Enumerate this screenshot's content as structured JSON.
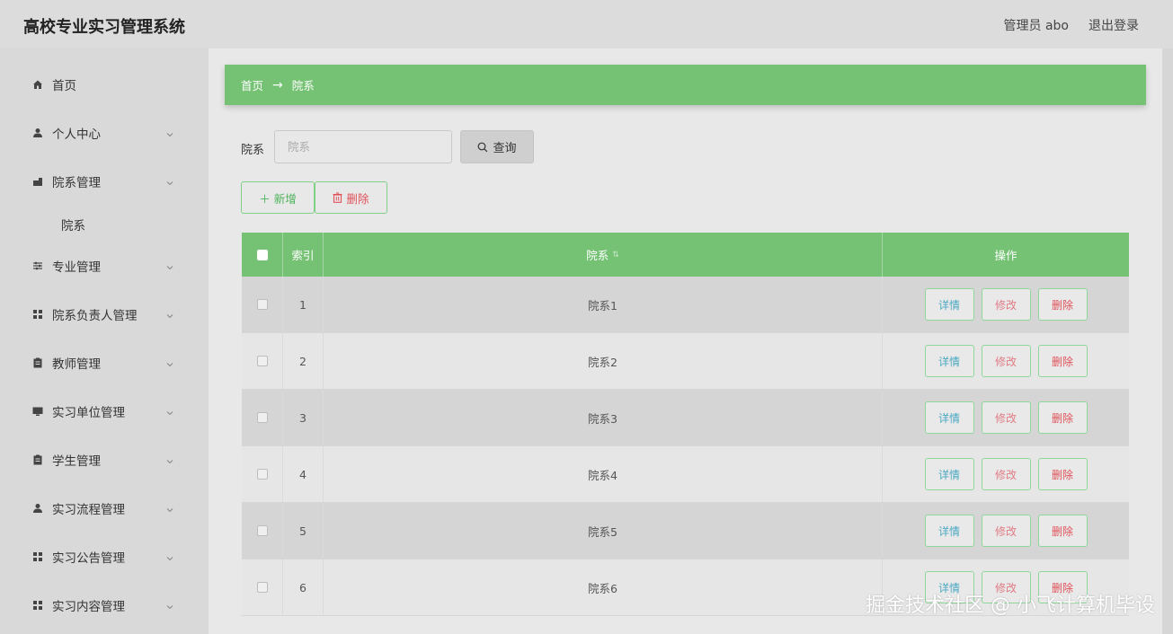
{
  "header": {
    "app_title": "高校专业实习管理系统",
    "user_label": "管理员 abo",
    "logout_label": "退出登录"
  },
  "sidebar": {
    "items": [
      {
        "label": "首页",
        "icon": "home-icon",
        "expandable": false
      },
      {
        "label": "个人中心",
        "icon": "user-icon",
        "expandable": true
      },
      {
        "label": "院系管理",
        "icon": "building-icon",
        "expandable": true
      },
      {
        "label": "院系",
        "icon": "",
        "expandable": false,
        "sub": true
      },
      {
        "label": "专业管理",
        "icon": "sliders-icon",
        "expandable": true
      },
      {
        "label": "院系负责人管理",
        "icon": "grid-icon",
        "expandable": true
      },
      {
        "label": "教师管理",
        "icon": "clipboard-icon",
        "expandable": true
      },
      {
        "label": "实习单位管理",
        "icon": "monitor-icon",
        "expandable": true
      },
      {
        "label": "学生管理",
        "icon": "clipboard-icon",
        "expandable": true
      },
      {
        "label": "实习流程管理",
        "icon": "user-icon",
        "expandable": true
      },
      {
        "label": "实习公告管理",
        "icon": "grid-icon",
        "expandable": true
      },
      {
        "label": "实习内容管理",
        "icon": "grid-icon",
        "expandable": true
      }
    ]
  },
  "breadcrumb": {
    "home": "首页",
    "separator": "→",
    "current": "院系"
  },
  "search": {
    "label": "院系",
    "placeholder": "院系",
    "value": "",
    "button_label": "查询"
  },
  "actions": {
    "add_label": "新增",
    "delete_label": "删除"
  },
  "table": {
    "columns": [
      "",
      "索引",
      "院系",
      "操作"
    ],
    "rows": [
      {
        "index": "1",
        "name": "院系1"
      },
      {
        "index": "2",
        "name": "院系2"
      },
      {
        "index": "3",
        "name": "院系3"
      },
      {
        "index": "4",
        "name": "院系4"
      },
      {
        "index": "5",
        "name": "院系5"
      },
      {
        "index": "6",
        "name": "院系6"
      }
    ],
    "op_labels": {
      "detail": "详情",
      "edit": "修改",
      "delete": "删除"
    }
  },
  "watermark": "掘金技术社区 @ 小飞计算机毕设",
  "colors": {
    "accent_green": "#75c274",
    "detail_blue": "#4aa8c2",
    "delete_red": "#e0525a"
  }
}
